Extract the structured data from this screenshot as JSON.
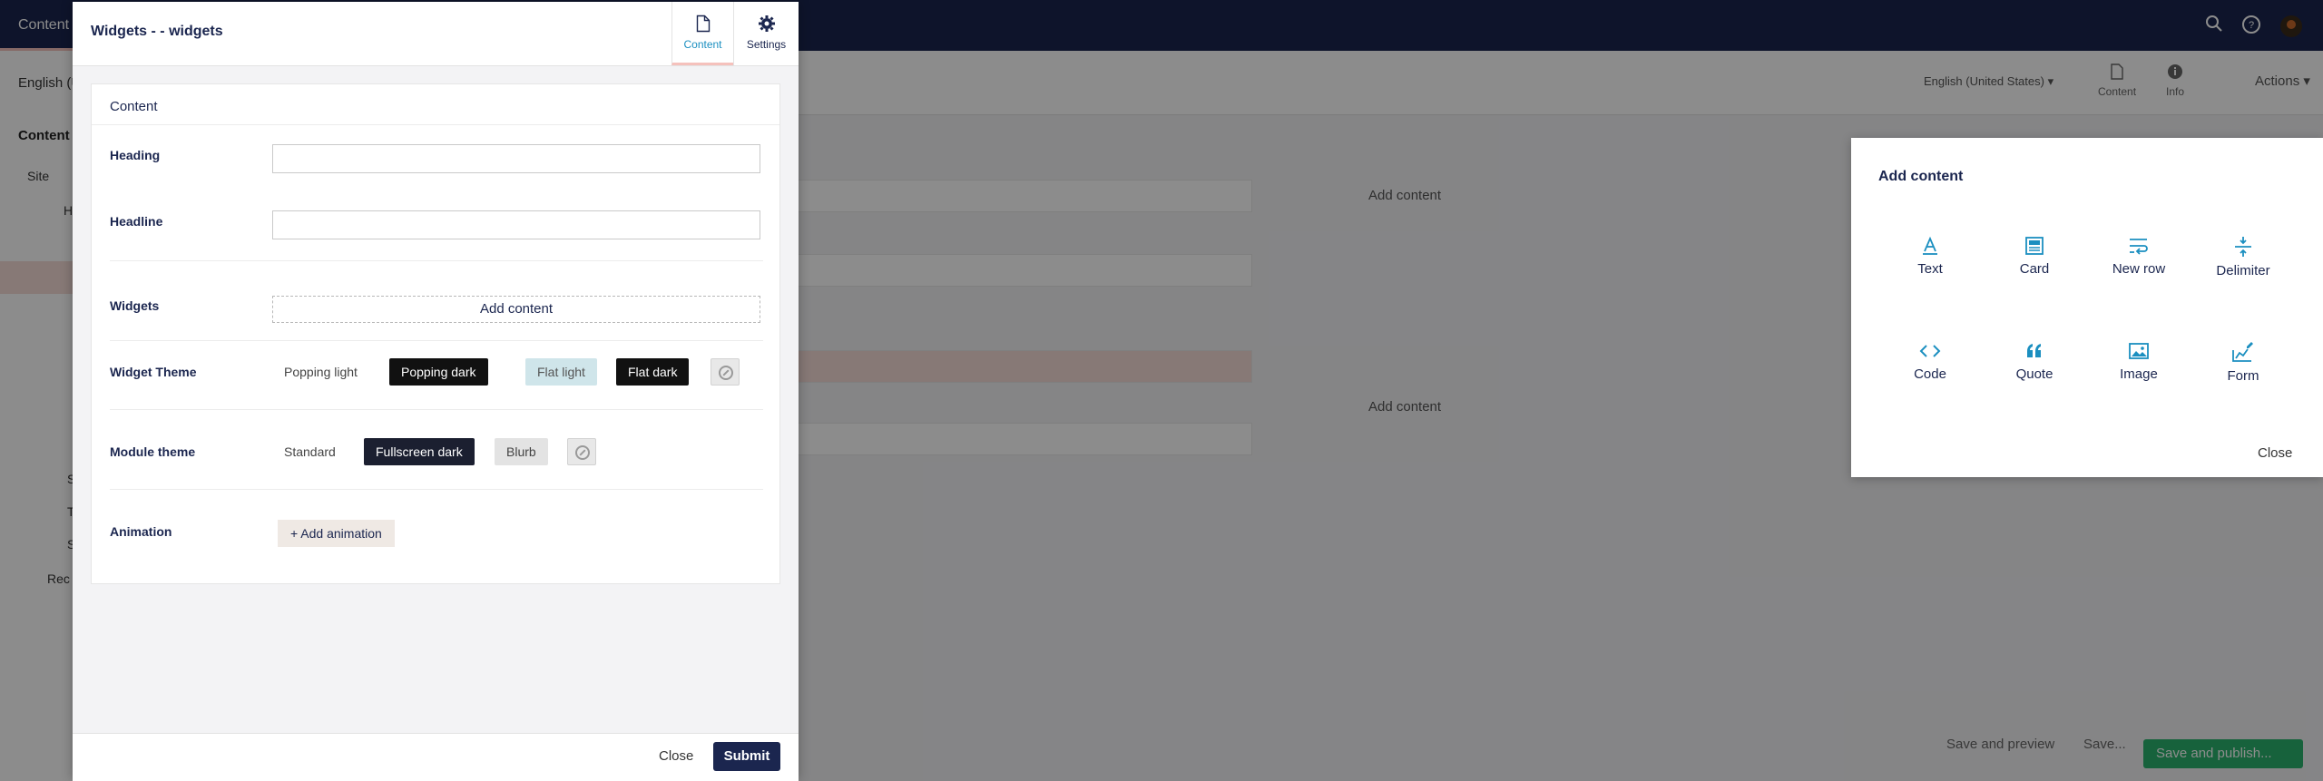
{
  "app": {
    "topbar_tab": "Content",
    "language_left": "English (U",
    "language_right": "English (United States)",
    "tabs": [
      {
        "label": "Content"
      },
      {
        "label": "Info"
      }
    ],
    "actions_label": "Actions",
    "tree_title": "Content",
    "tree_items": [
      "Site",
      "H",
      "S",
      "T",
      "S",
      "Rec"
    ],
    "add_content_labels": [
      "Add content",
      "Add content"
    ],
    "bottom": {
      "save_preview": "Save and preview",
      "save": "Save...",
      "save_publish": "Save and publish..."
    }
  },
  "modal": {
    "title": "Widgets - - widgets",
    "header_tabs": [
      {
        "label": "Content",
        "icon": "document-icon"
      },
      {
        "label": "Settings",
        "icon": "gear-icon"
      }
    ],
    "section_title": "Content",
    "fields": {
      "heading": {
        "label": "Heading",
        "value": ""
      },
      "headline": {
        "label": "Headline",
        "value": ""
      },
      "widgets": {
        "label": "Widgets",
        "add_label": "Add content"
      },
      "widget_theme": {
        "label": "Widget Theme",
        "options": [
          "Popping light",
          "Popping dark",
          "Flat light",
          "Flat dark"
        ]
      },
      "module_theme": {
        "label": "Module theme",
        "options": [
          "Standard",
          "Fullscreen dark",
          "Blurb"
        ]
      },
      "animation": {
        "label": "Animation",
        "button": "Add animation"
      }
    },
    "footer": {
      "close": "Close",
      "submit": "Submit"
    }
  },
  "popover": {
    "title": "Add content",
    "items": [
      {
        "label": "Text",
        "icon": "text-icon"
      },
      {
        "label": "Card",
        "icon": "card-icon"
      },
      {
        "label": "New row",
        "icon": "new-row-icon"
      },
      {
        "label": "Delimiter",
        "icon": "delimiter-icon"
      },
      {
        "label": "Code",
        "icon": "code-icon"
      },
      {
        "label": "Quote",
        "icon": "quote-icon"
      },
      {
        "label": "Image",
        "icon": "image-icon"
      },
      {
        "label": "Form",
        "icon": "form-icon"
      }
    ],
    "close": "Close"
  },
  "colors": {
    "navy": "#1b264f",
    "accent": "#1b8fc0",
    "publish_green": "#2bb36e",
    "tab_underline": "#f5c1bc"
  }
}
